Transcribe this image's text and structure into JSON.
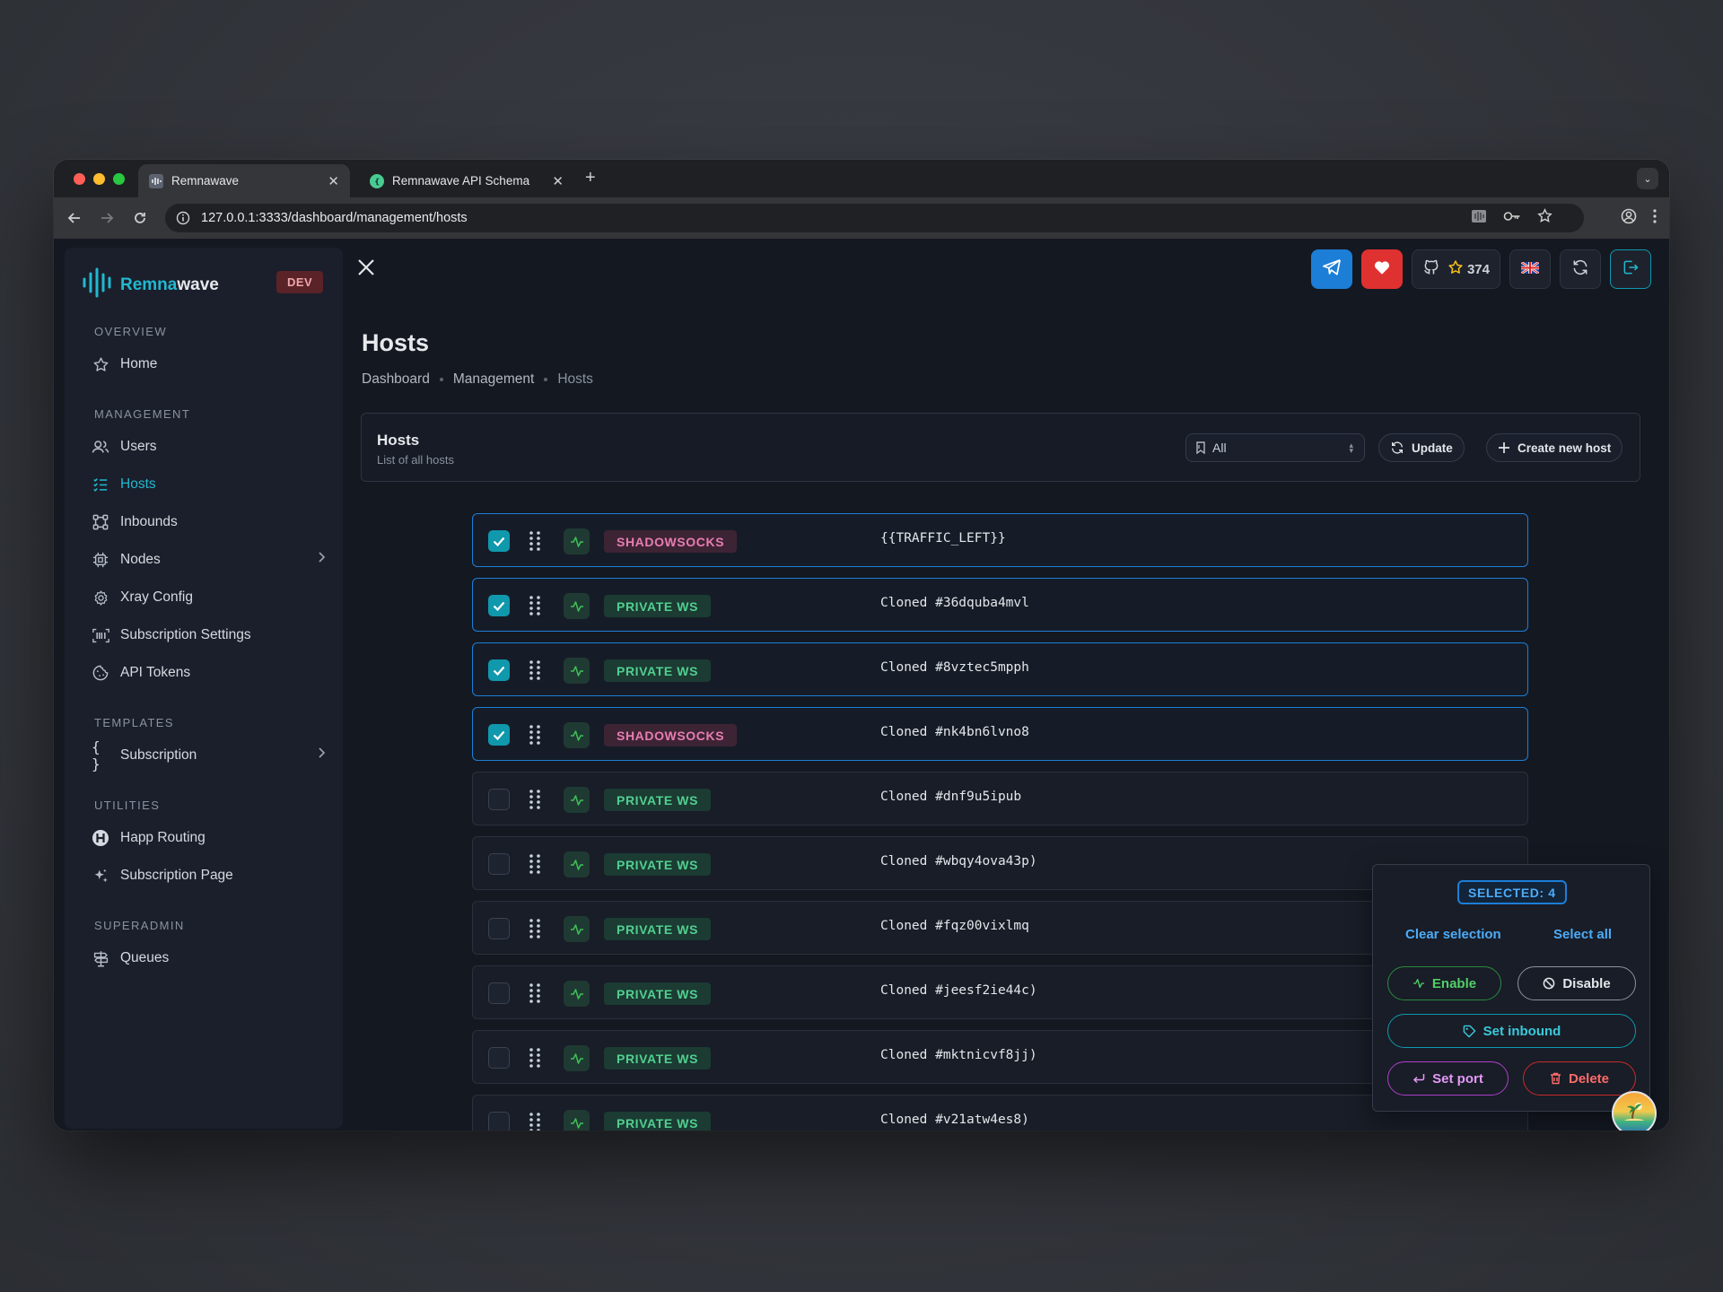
{
  "browser": {
    "tabs": [
      {
        "label": "Remnawave",
        "active": true
      },
      {
        "label": "Remnawave API Schema",
        "active": false
      }
    ],
    "url": "127.0.0.1:3333/dashboard/management/hosts"
  },
  "sidebar": {
    "brand_accent": "Remna",
    "brand_rest": "wave",
    "env_badge": "DEV",
    "sections": {
      "overview": "OVERVIEW",
      "management": "MANAGEMENT",
      "templates": "TEMPLATES",
      "utilities": "UTILITIES",
      "superadmin": "SUPERADMIN"
    },
    "items": {
      "home": "Home",
      "users": "Users",
      "hosts": "Hosts",
      "inbounds": "Inbounds",
      "nodes": "Nodes",
      "xray_config": "Xray Config",
      "subscription_settings": "Subscription Settings",
      "api_tokens": "API Tokens",
      "subscription": "Subscription",
      "happ_routing": "Happ Routing",
      "subscription_page": "Subscription Page",
      "queues": "Queues"
    },
    "active_item": "Hosts"
  },
  "header": {
    "github_stars": "374"
  },
  "page": {
    "title": "Hosts",
    "breadcrumbs": [
      "Dashboard",
      "Management",
      "Hosts"
    ]
  },
  "hosts_card": {
    "title": "Hosts",
    "subtitle": "List of all hosts",
    "filter_value": "All",
    "update_label": "Update",
    "create_label": "Create new host"
  },
  "hosts": [
    {
      "protocol": "SHADOWSOCKS",
      "name": "{{TRAFFIC_LEFT}}",
      "selected": true
    },
    {
      "protocol": "PRIVATE WS",
      "name": "Cloned #36dquba4mvl",
      "selected": true
    },
    {
      "protocol": "PRIVATE WS",
      "name": "Cloned #8vztec5mpph",
      "selected": true
    },
    {
      "protocol": "SHADOWSOCKS",
      "name": "Cloned #nk4bn6lvno8",
      "selected": true
    },
    {
      "protocol": "PRIVATE WS",
      "name": "Cloned #dnf9u5ipub",
      "selected": false
    },
    {
      "protocol": "PRIVATE WS",
      "name": "Cloned #wbqy4ova43p)",
      "selected": false
    },
    {
      "protocol": "PRIVATE WS",
      "name": "Cloned #fqz00vixlmq",
      "selected": false
    },
    {
      "protocol": "PRIVATE WS",
      "name": "Cloned #jeesf2ie44c)",
      "selected": false
    },
    {
      "protocol": "PRIVATE WS",
      "name": "Cloned #mktnicvf8jj)",
      "selected": false
    },
    {
      "protocol": "PRIVATE WS",
      "name": "Cloned #v21atw4es8)",
      "selected": false
    }
  ],
  "selection_panel": {
    "count_label": "SELECTED: 4",
    "clear_label": "Clear selection",
    "select_all_label": "Select all",
    "enable_label": "Enable",
    "disable_label": "Disable",
    "set_inbound_label": "Set inbound",
    "set_port_label": "Set port",
    "delete_label": "Delete"
  },
  "colors": {
    "accent": "#22b8cf",
    "selected_border": "#1c7ed6",
    "private_ws": "#51cf8f",
    "shadowsocks": "#e87db2"
  }
}
